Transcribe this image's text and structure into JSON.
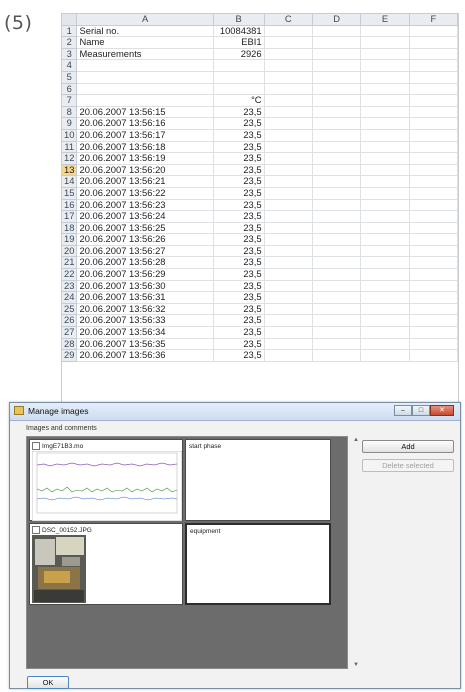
{
  "step_label": "(5)",
  "spreadsheet": {
    "columns": [
      "A",
      "B",
      "C",
      "D",
      "E",
      "F"
    ],
    "selected_row": 13,
    "header_rows": [
      {
        "row": 1,
        "a": "Serial no.",
        "b": "10084381"
      },
      {
        "row": 2,
        "a": "Name",
        "b": "EBI1"
      },
      {
        "row": 3,
        "a": "Measurements",
        "b": "2926"
      },
      {
        "row": 4,
        "a": "",
        "b": ""
      },
      {
        "row": 5,
        "a": "",
        "b": ""
      },
      {
        "row": 6,
        "a": "",
        "b": ""
      },
      {
        "row": 7,
        "a": "",
        "b": "°C"
      }
    ],
    "data_rows": [
      {
        "row": 8,
        "a": "20.06.2007 13:56:15",
        "b": "23,5"
      },
      {
        "row": 9,
        "a": "20.06.2007 13:56:16",
        "b": "23,5"
      },
      {
        "row": 10,
        "a": "20.06.2007 13:56:17",
        "b": "23,5"
      },
      {
        "row": 11,
        "a": "20.06.2007 13:56:18",
        "b": "23,5"
      },
      {
        "row": 12,
        "a": "20.06.2007 13:56:19",
        "b": "23,5"
      },
      {
        "row": 13,
        "a": "20.06.2007 13:56:20",
        "b": "23,5"
      },
      {
        "row": 14,
        "a": "20.06.2007 13:56:21",
        "b": "23,5"
      },
      {
        "row": 15,
        "a": "20.06.2007 13:56:22",
        "b": "23,5"
      },
      {
        "row": 16,
        "a": "20.06.2007 13:56:23",
        "b": "23,5"
      },
      {
        "row": 17,
        "a": "20.06.2007 13:56:24",
        "b": "23,5"
      },
      {
        "row": 18,
        "a": "20.06.2007 13:56:25",
        "b": "23,5"
      },
      {
        "row": 19,
        "a": "20.06.2007 13:56:26",
        "b": "23,5"
      },
      {
        "row": 20,
        "a": "20.06.2007 13:56:27",
        "b": "23,5"
      },
      {
        "row": 21,
        "a": "20.06.2007 13:56:28",
        "b": "23,5"
      },
      {
        "row": 22,
        "a": "20.06.2007 13:56:29",
        "b": "23,5"
      },
      {
        "row": 23,
        "a": "20.06.2007 13:56:30",
        "b": "23,5"
      },
      {
        "row": 24,
        "a": "20.06.2007 13:56:31",
        "b": "23,5"
      },
      {
        "row": 25,
        "a": "20.06.2007 13:56:32",
        "b": "23,5"
      },
      {
        "row": 26,
        "a": "20.06.2007 13:56:33",
        "b": "23,5"
      },
      {
        "row": 27,
        "a": "20.06.2007 13:56:34",
        "b": "23,5"
      },
      {
        "row": 28,
        "a": "20.06.2007 13:56:35",
        "b": "23,5"
      },
      {
        "row": 29,
        "a": "20.06.2007 13:56:36",
        "b": "23,5"
      }
    ]
  },
  "dialog": {
    "title": "Manage images",
    "group_label": "Images and comments",
    "items": [
      {
        "filename": "ImgE71B3.mo",
        "comment": "start phase",
        "kind": "chart"
      },
      {
        "filename": "DSC_00152.JPG",
        "comment": "equipment",
        "kind": "photo"
      }
    ],
    "add_label": "Add",
    "delete_label": "Delete selected",
    "ok_label": "OK",
    "icons": {
      "window": "folder-image-icon",
      "minimize": "minimize-icon",
      "maximize": "maximize-icon",
      "close": "close-icon",
      "scroll_up": "scroll-up-arrow-icon",
      "scroll_down": "scroll-down-arrow-icon"
    },
    "colors": {
      "close_button": "#c44a30",
      "grid_background": "#6c6c6c",
      "selected_row_header": "#f7d58a"
    }
  }
}
